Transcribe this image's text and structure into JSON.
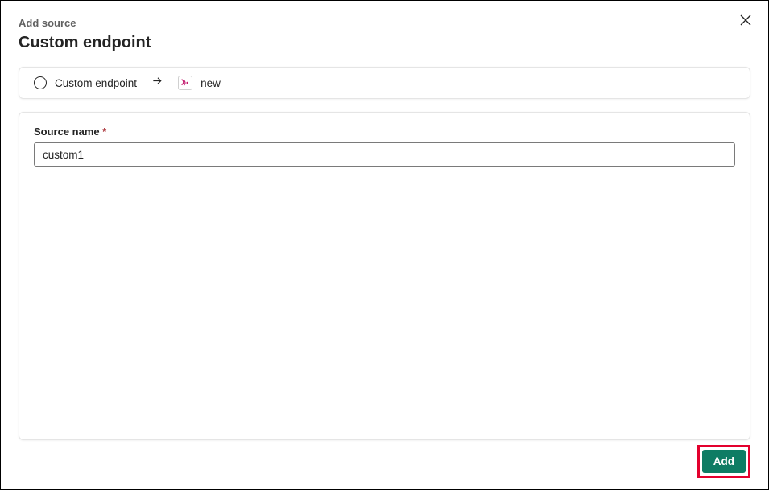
{
  "header": {
    "subtitle": "Add source",
    "title": "Custom endpoint"
  },
  "breadcrumb": {
    "step1_label": "Custom endpoint",
    "step2_label": "new"
  },
  "form": {
    "source_name_label": "Source name",
    "required_mark": "*",
    "source_name_value": "custom1"
  },
  "actions": {
    "add_label": "Add"
  }
}
